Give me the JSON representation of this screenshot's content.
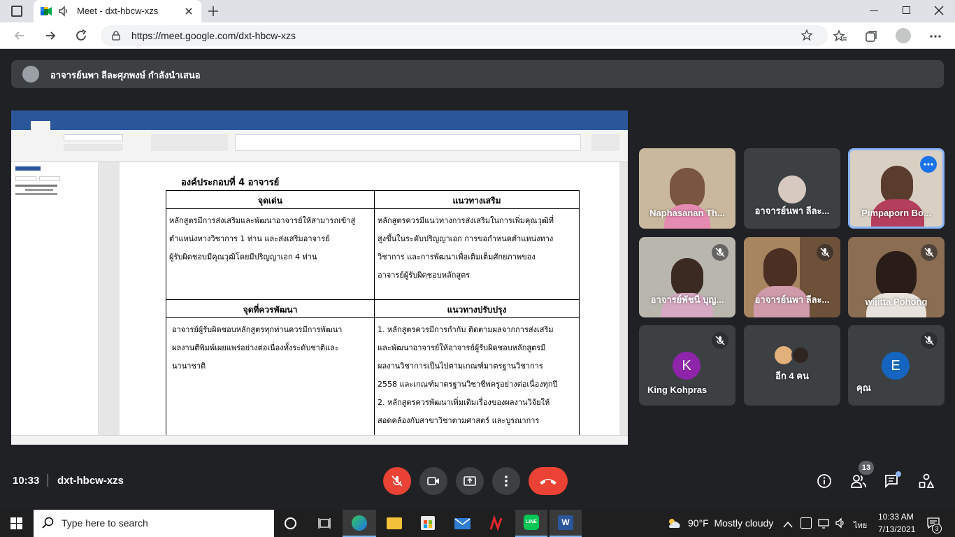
{
  "browser": {
    "tab_title": "Meet - dxt-hbcw-xzs",
    "url": "https://meet.google.com/dxt-hbcw-xzs"
  },
  "meet": {
    "presenter_label": "อาจารย์นพา ลีละศุภพงษ์ กำลังนำเสนอ",
    "time": "10:33",
    "meeting_code": "dxt-hbcw-xzs",
    "people_count": "13",
    "participants": [
      {
        "name": "Naphasanan Th...",
        "kind": "video"
      },
      {
        "name": "อาจารย์นพา ลีละ...",
        "kind": "photo"
      },
      {
        "name": "Pimpaporn Bo...",
        "kind": "video"
      },
      {
        "name": "อาจารย์พัชนี บุญ...",
        "kind": "video"
      },
      {
        "name": "อาจารย์นพา ลีละ...",
        "kind": "video"
      },
      {
        "name": "wijitta Pohong",
        "kind": "video"
      },
      {
        "name": "King Kohpras",
        "initial": "K",
        "color": "#8e24aa"
      },
      {
        "name": "อีก 4 คน",
        "kind": "more"
      },
      {
        "name": "คุณ",
        "initial": "E",
        "color": "#1565c0"
      }
    ]
  },
  "document": {
    "heading": "องค์ประกอบที่ 4 อาจารย์",
    "table": {
      "header1": [
        "จุดเด่น",
        "แนวทางเสริม"
      ],
      "row1": [
        [
          "หลักสูตรมีการส่งเสริมและพัฒนาอาจารย์ให้สามารถเข้าสู่",
          "ตำแหน่งทางวิชาการ 1 ท่าน และส่งเสริมอาจารย์",
          "ผู้รับผิดชอบมีคุณวุฒิโดยมีปริญญาเอก 4 ท่าน"
        ],
        [
          "หลักสูตรควรมีแนวทางการส่งเสริมในการเพิ่มคุณวุฒิที่",
          "สูงขึ้นในระดับปริญญาเอก การขอกำหนดตำแหน่งทาง",
          "วิชาการ และการพัฒนาเพื่อเติมเต็มศักยภาพของ",
          "อาจารย์ผู้รับผิดชอบหลักสูตร"
        ]
      ],
      "header2": [
        "จุดที่ควรพัฒนา",
        "แนวทางปรับปรุง"
      ],
      "row2": [
        [
          "อาจารย์ผู้รับผิดชอบหลักสูตรทุกท่านควรมีการพัฒนา",
          "ผลงานตีพิมพ์เผยแพร่อย่างต่อเนื่องทั้งระดับชาติและ",
          "นานาชาติ"
        ],
        [
          "1. หลักสูตรควรมีการกำกับ ติดตามผลจากการส่งเสริม",
          "และพัฒนาอาจารย์ให้อาจารย์ผู้รับผิดชอบหลักสูตรมี",
          "ผลงานวิชาการเป็นไปตามเกณฑ์มาตรฐานวิชาการ",
          "2558 และเกณฑ์มาตรฐานวิชาชีพครูอย่างต่อเนื่องทุกปี",
          "2. หลักสูตรควรพัฒนาเพิ่มเติมเรื่องของผลงานวิจัยให้",
          "สอดคล้องกับสาขาวิชาตามศาสตร์ และบูรณาการ"
        ]
      ]
    }
  },
  "taskbar": {
    "search_placeholder": "Type here to search",
    "weather": "90°F  Mostly cloudy",
    "lang": "ไทย",
    "clock_time": "10:33 AM",
    "clock_date": "7/13/2021",
    "notif_count": "3"
  },
  "colors": {
    "meet_bg": "#202124",
    "end_call": "#ea4335",
    "word_blue": "#2b579a"
  }
}
